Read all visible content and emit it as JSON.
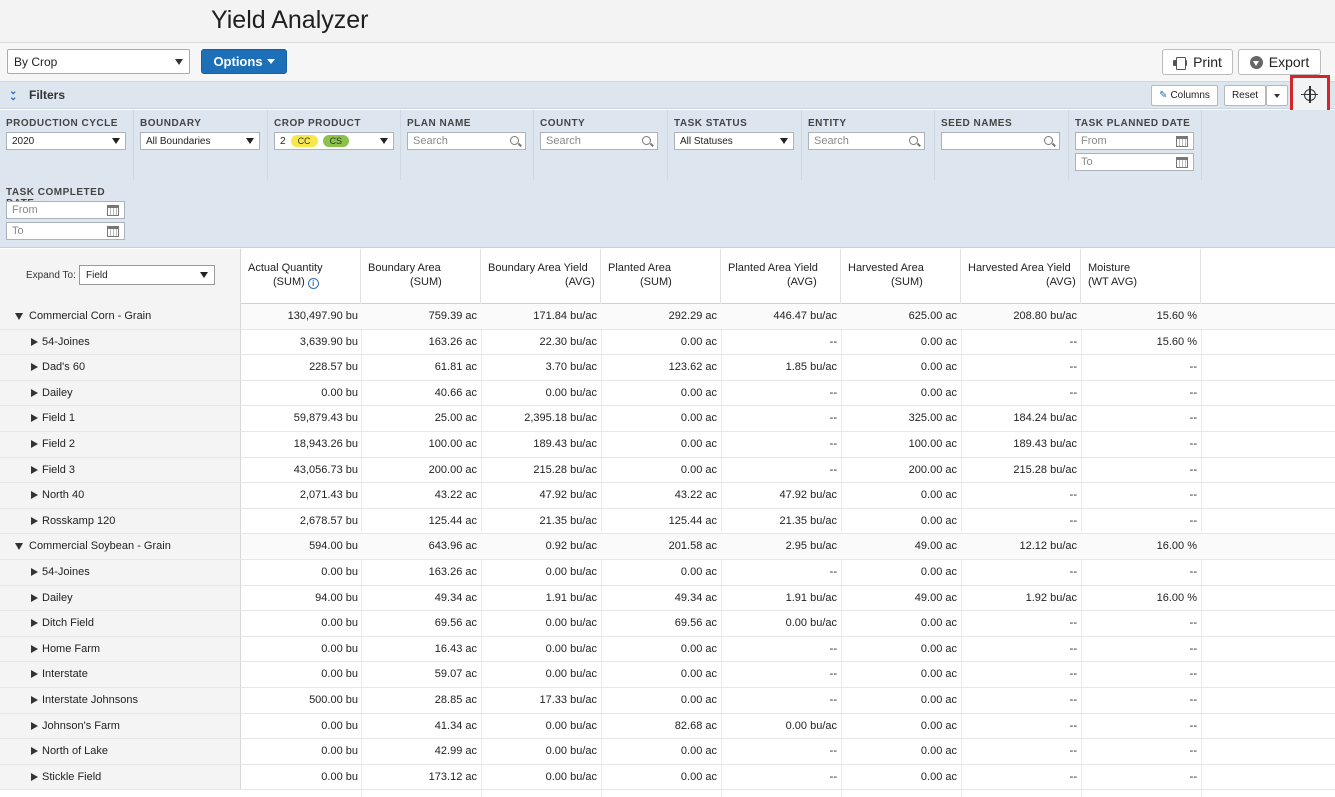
{
  "app": {
    "title": "Yield Analyzer"
  },
  "toolbar": {
    "view_select": "By Crop",
    "options_label": "Options",
    "print_label": "Print",
    "export_label": "Export"
  },
  "filters": {
    "label": "Filters",
    "columns_label": "Columns",
    "reset_label": "Reset",
    "production_cycle": {
      "label": "PRODUCTION CYCLE",
      "value": "2020"
    },
    "boundary": {
      "label": "BOUNDARY",
      "value": "All Boundaries"
    },
    "crop_product": {
      "label": "CROP PRODUCT",
      "count": "2",
      "pills": [
        "CC",
        "CS"
      ]
    },
    "plan_name": {
      "label": "PLAN NAME",
      "placeholder": "Search"
    },
    "county": {
      "label": "COUNTY",
      "placeholder": "Search"
    },
    "task_status": {
      "label": "TASK STATUS",
      "value": "All Statuses"
    },
    "entity": {
      "label": "ENTITY",
      "placeholder": "Search"
    },
    "seed_names": {
      "label": "SEED NAMES",
      "placeholder": ""
    },
    "task_planned_date": {
      "label": "TASK PLANNED DATE",
      "from": "From",
      "to": "To"
    },
    "task_completed_date": {
      "label": "TASK COMPLETED DATE",
      "from": "From",
      "to": "To"
    }
  },
  "grid": {
    "expand_label": "Expand To:",
    "expand_value": "Field",
    "columns": [
      {
        "line1": "Actual Quantity",
        "line2": "(SUM)",
        "info": true
      },
      {
        "line1": "Boundary Area",
        "line2": "(SUM)"
      },
      {
        "line1": "Boundary Area Yield",
        "line2": "(AVG)"
      },
      {
        "line1": "Planted Area",
        "line2": "(SUM)"
      },
      {
        "line1": "Planted Area Yield",
        "line2": "(AVG)"
      },
      {
        "line1": "Harvested Area",
        "line2": "(SUM)"
      },
      {
        "line1": "Harvested Area Yield",
        "line2": "(AVG)"
      },
      {
        "line1": "Moisture",
        "line2": "(WT AVG)"
      }
    ],
    "rows": [
      {
        "type": "group",
        "name": "Commercial Corn - Grain",
        "values": [
          "130,497.90 bu",
          "759.39 ac",
          "171.84 bu/ac",
          "292.29 ac",
          "446.47 bu/ac",
          "625.00 ac",
          "208.80 bu/ac",
          "15.60 %"
        ]
      },
      {
        "type": "child",
        "name": "54-Joines",
        "values": [
          "3,639.90 bu",
          "163.26 ac",
          "22.30 bu/ac",
          "0.00 ac",
          "--",
          "0.00 ac",
          "--",
          "15.60 %"
        ]
      },
      {
        "type": "child",
        "name": "Dad's 60",
        "values": [
          "228.57 bu",
          "61.81 ac",
          "3.70 bu/ac",
          "123.62 ac",
          "1.85 bu/ac",
          "0.00 ac",
          "--",
          "--"
        ]
      },
      {
        "type": "child",
        "name": "Dailey",
        "values": [
          "0.00 bu",
          "40.66 ac",
          "0.00 bu/ac",
          "0.00 ac",
          "--",
          "0.00 ac",
          "--",
          "--"
        ]
      },
      {
        "type": "child",
        "name": "Field 1",
        "values": [
          "59,879.43 bu",
          "25.00 ac",
          "2,395.18 bu/ac",
          "0.00 ac",
          "--",
          "325.00 ac",
          "184.24 bu/ac",
          "--"
        ]
      },
      {
        "type": "child",
        "name": "Field 2",
        "values": [
          "18,943.26 bu",
          "100.00 ac",
          "189.43 bu/ac",
          "0.00 ac",
          "--",
          "100.00 ac",
          "189.43 bu/ac",
          "--"
        ]
      },
      {
        "type": "child",
        "name": "Field 3",
        "values": [
          "43,056.73 bu",
          "200.00 ac",
          "215.28 bu/ac",
          "0.00 ac",
          "--",
          "200.00 ac",
          "215.28 bu/ac",
          "--"
        ]
      },
      {
        "type": "child",
        "name": "North 40",
        "values": [
          "2,071.43 bu",
          "43.22 ac",
          "47.92 bu/ac",
          "43.22 ac",
          "47.92 bu/ac",
          "0.00 ac",
          "--",
          "--"
        ]
      },
      {
        "type": "child",
        "name": "Rosskamp 120",
        "values": [
          "2,678.57 bu",
          "125.44 ac",
          "21.35 bu/ac",
          "125.44 ac",
          "21.35 bu/ac",
          "0.00 ac",
          "--",
          "--"
        ]
      },
      {
        "type": "group",
        "name": "Commercial Soybean - Grain",
        "values": [
          "594.00 bu",
          "643.96 ac",
          "0.92 bu/ac",
          "201.58 ac",
          "2.95 bu/ac",
          "49.00 ac",
          "12.12 bu/ac",
          "16.00 %"
        ]
      },
      {
        "type": "child",
        "name": "54-Joines",
        "values": [
          "0.00 bu",
          "163.26 ac",
          "0.00 bu/ac",
          "0.00 ac",
          "--",
          "0.00 ac",
          "--",
          "--"
        ]
      },
      {
        "type": "child",
        "name": "Dailey",
        "values": [
          "94.00 bu",
          "49.34 ac",
          "1.91 bu/ac",
          "49.34 ac",
          "1.91 bu/ac",
          "49.00 ac",
          "1.92 bu/ac",
          "16.00 %"
        ]
      },
      {
        "type": "child",
        "name": "Ditch Field",
        "values": [
          "0.00 bu",
          "69.56 ac",
          "0.00 bu/ac",
          "69.56 ac",
          "0.00 bu/ac",
          "0.00 ac",
          "--",
          "--"
        ]
      },
      {
        "type": "child",
        "name": "Home Farm",
        "values": [
          "0.00 bu",
          "16.43 ac",
          "0.00 bu/ac",
          "0.00 ac",
          "--",
          "0.00 ac",
          "--",
          "--"
        ]
      },
      {
        "type": "child",
        "name": "Interstate",
        "values": [
          "0.00 bu",
          "59.07 ac",
          "0.00 bu/ac",
          "0.00 ac",
          "--",
          "0.00 ac",
          "--",
          "--"
        ]
      },
      {
        "type": "child",
        "name": "Interstate Johnsons",
        "values": [
          "500.00 bu",
          "28.85 ac",
          "17.33 bu/ac",
          "0.00 ac",
          "--",
          "0.00 ac",
          "--",
          "--"
        ]
      },
      {
        "type": "child",
        "name": "Johnson's Farm",
        "values": [
          "0.00 bu",
          "41.34 ac",
          "0.00 bu/ac",
          "82.68 ac",
          "0.00 bu/ac",
          "0.00 ac",
          "--",
          "--"
        ]
      },
      {
        "type": "child",
        "name": "North of Lake",
        "values": [
          "0.00 bu",
          "42.99 ac",
          "0.00 bu/ac",
          "0.00 ac",
          "--",
          "0.00 ac",
          "--",
          "--"
        ]
      },
      {
        "type": "child",
        "name": "Stickle Field",
        "values": [
          "0.00 bu",
          "173.12 ac",
          "0.00 bu/ac",
          "0.00 ac",
          "--",
          "0.00 ac",
          "--",
          "--"
        ]
      }
    ]
  },
  "colors": {
    "accent": "#1d6fb7",
    "filter_bg": "#dde6ee",
    "highlight": "#d0262c",
    "pill_cc": "#f6e84a",
    "pill_cs": "#8bc34a"
  }
}
